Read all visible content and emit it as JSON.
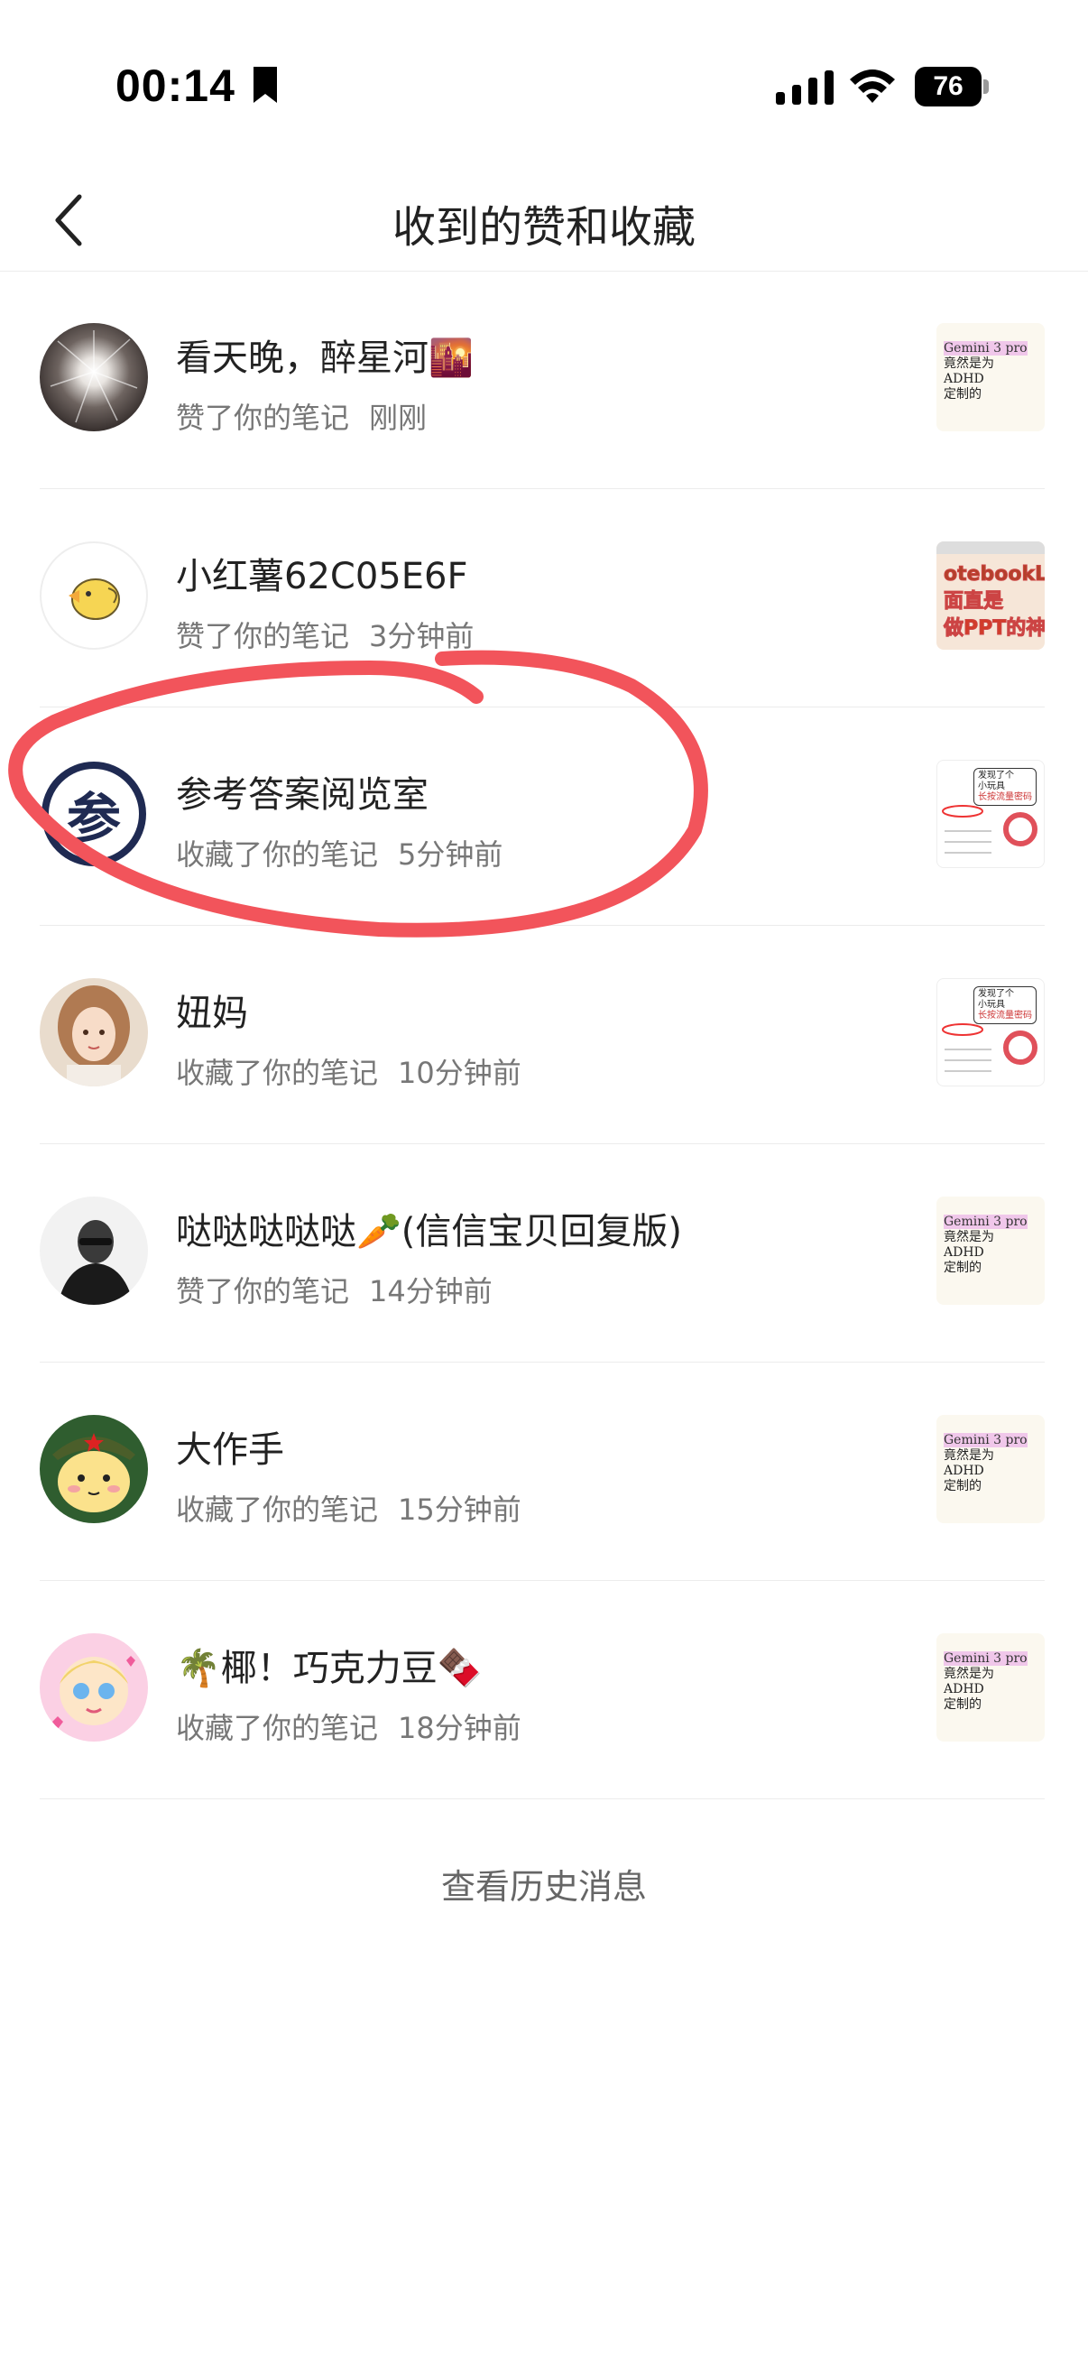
{
  "status_bar": {
    "time": "00:14",
    "battery": "76"
  },
  "nav": {
    "title": "收到的赞和收藏"
  },
  "notifications": [
    {
      "name": "看天晚，醉星河🌇",
      "action": "赞了你的笔记",
      "time": "刚刚",
      "thumb_text": [
        "Gemini 3 pro",
        "竟然是为",
        "ADHD",
        "定制的"
      ]
    },
    {
      "name": "小红薯62C05E6F",
      "action": "赞了你的笔记",
      "time": "3分钟前",
      "thumb_text": [
        "otebookL",
        "面直是",
        "做PPT的神"
      ]
    },
    {
      "name": "参考答案阅览室",
      "action": "收藏了你的笔记",
      "time": "5分钟前",
      "avatar_char": "参",
      "thumb_text": [
        "发现了个",
        "小玩具",
        "长按流量密码"
      ]
    },
    {
      "name": "妞妈",
      "action": "收藏了你的笔记",
      "time": "10分钟前",
      "thumb_text": [
        "发现了个",
        "小玩具",
        "长按流量密码"
      ]
    },
    {
      "name": "哒哒哒哒哒🥕(信信宝贝回复版)",
      "action": "赞了你的笔记",
      "time": "14分钟前",
      "thumb_text": [
        "Gemini 3 pro",
        "竟然是为",
        "ADHD",
        "定制的"
      ]
    },
    {
      "name": "大作手",
      "action": "收藏了你的笔记",
      "time": "15分钟前",
      "thumb_text": [
        "Gemini 3 pro",
        "竟然是为",
        "ADHD",
        "定制的"
      ]
    },
    {
      "name": "🌴椰！巧克力豆🍫",
      "action": "收藏了你的笔记",
      "time": "18分钟前",
      "thumb_text": [
        "Gemini 3 pro",
        "竟然是为",
        "ADHD",
        "定制的"
      ]
    }
  ],
  "footer": {
    "history_link": "查看历史消息"
  },
  "colors": {
    "annotation": "#f2545b",
    "divider": "#ececec",
    "secondary_text": "#777777"
  }
}
